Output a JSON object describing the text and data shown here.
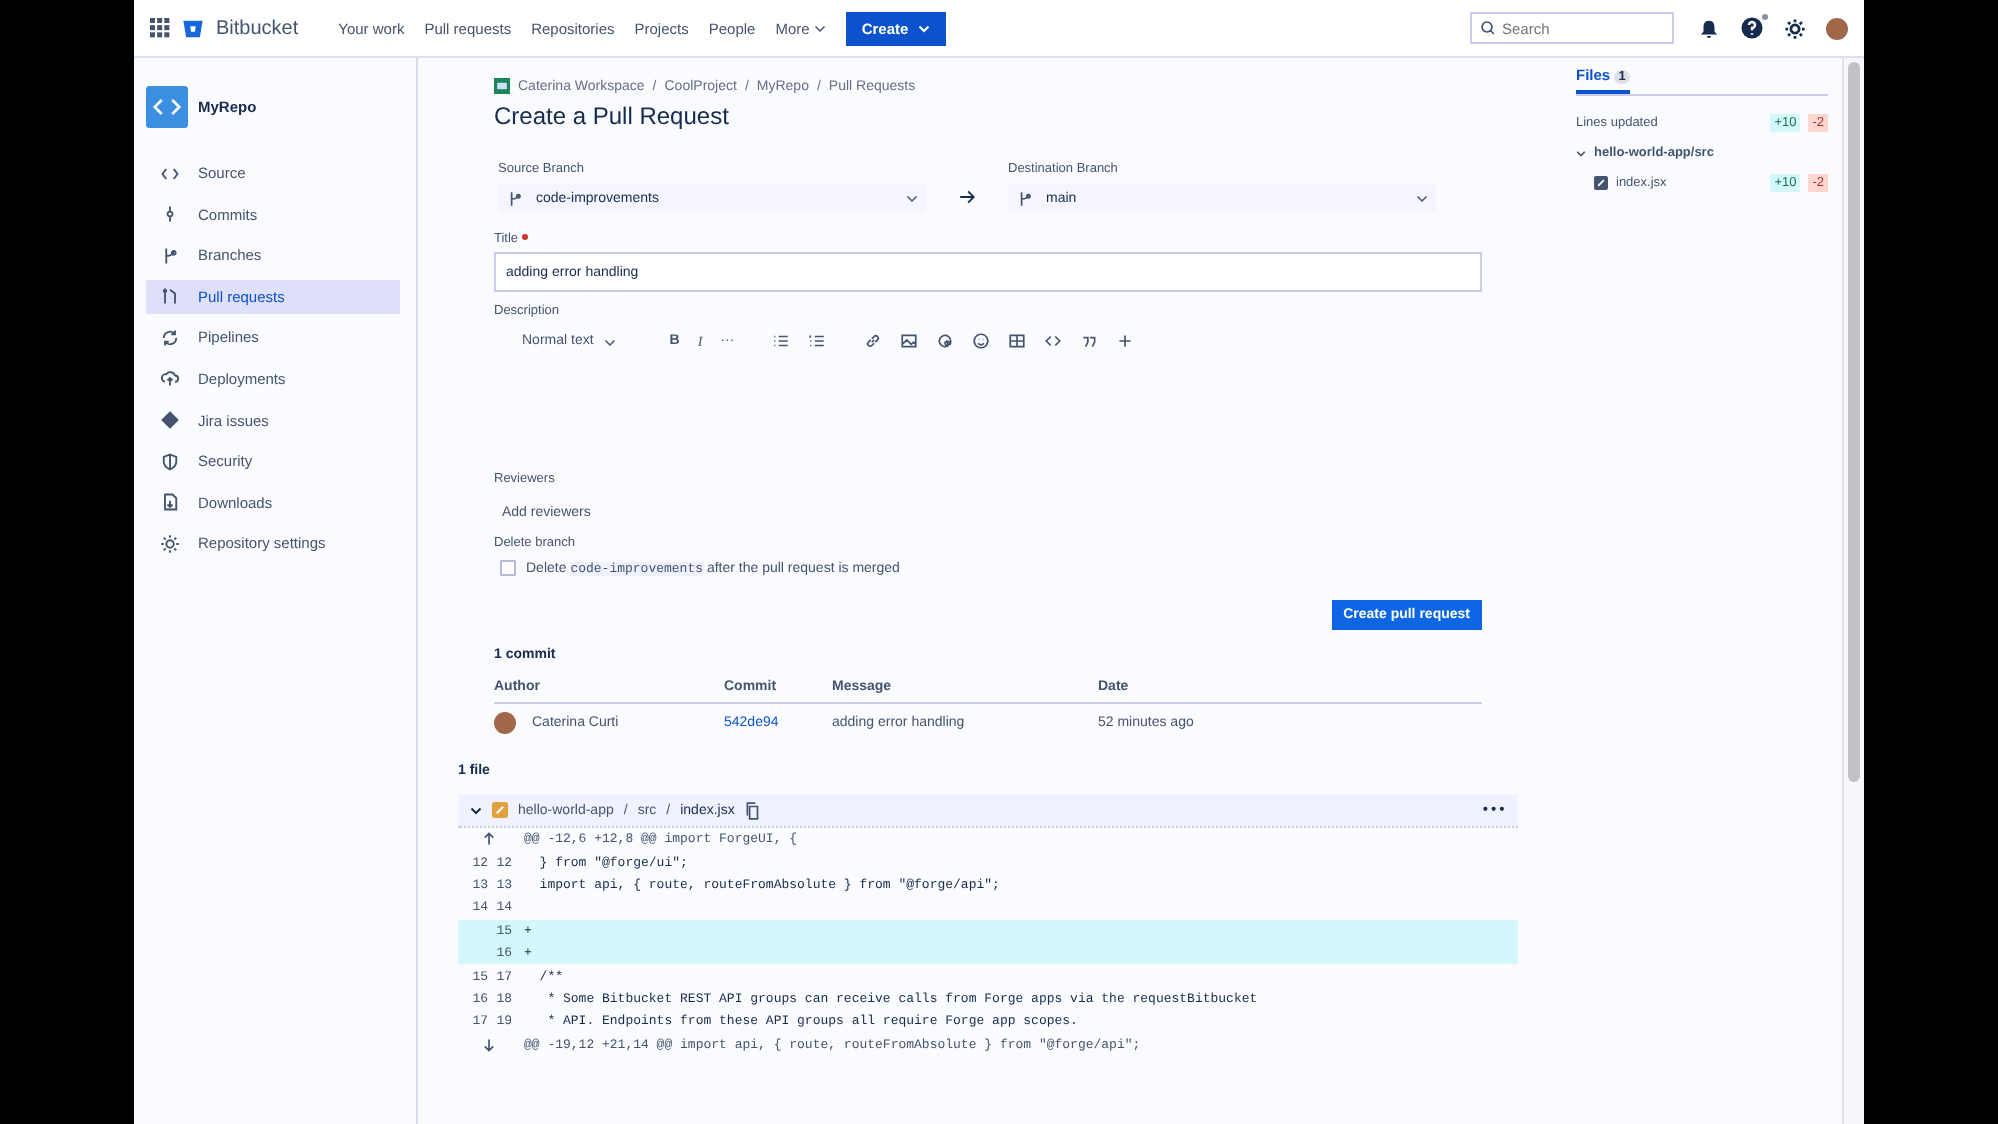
{
  "topbar": {
    "product": "Bitbucket",
    "nav": [
      "Your work",
      "Pull requests",
      "Repositories",
      "Projects",
      "People",
      "More"
    ],
    "create": "Create",
    "search": {
      "placeholder": "Search"
    },
    "help_dot": true
  },
  "sidebar": {
    "repo": "MyRepo",
    "items": [
      {
        "label": "Source",
        "selected": false
      },
      {
        "label": "Commits",
        "selected": false
      },
      {
        "label": "Branches",
        "selected": false
      },
      {
        "label": "Pull requests",
        "selected": true
      },
      {
        "label": "Pipelines",
        "selected": false
      },
      {
        "label": "Deployments",
        "selected": false
      },
      {
        "label": "Jira issues",
        "selected": false
      },
      {
        "label": "Security",
        "selected": false
      },
      {
        "label": "Downloads",
        "selected": false
      },
      {
        "label": "Repository settings",
        "selected": false
      }
    ]
  },
  "breadcrumbs": [
    {
      "label": "Caterina Workspace"
    },
    {
      "separator": "/",
      "label": "CoolProject"
    },
    {
      "separator": "/",
      "label": "MyRepo"
    },
    {
      "separator": "/",
      "label": "Pull Requests"
    }
  ],
  "title": "Create a Pull Request",
  "source_branch": {
    "label": "Source Branch",
    "value": "code-improvements"
  },
  "destination_branch": {
    "label": "Destination Branch",
    "value": "main"
  },
  "title_field": {
    "label": "Title",
    "required": true,
    "value": "adding error handling"
  },
  "description": {
    "label": "Description",
    "format": "Normal text",
    "toolbar_text": [
      "B",
      "I",
      "···"
    ]
  },
  "reviewers": {
    "label": "Reviewers",
    "placeholder": "Add reviewers"
  },
  "delete_branch": {
    "label": "Delete branch",
    "checked": false,
    "before": "Delete",
    "branch": "code-improvements",
    "after": "after the pull request is merged"
  },
  "submit": "Create pull request",
  "commits": {
    "count": "1 commit",
    "columns": [
      "Author",
      "Commit",
      "Message",
      "Date"
    ],
    "rows": [
      {
        "author": "Caterina Curti",
        "commit": "542de94",
        "message": "adding error handling",
        "date": "52 minutes ago"
      }
    ]
  },
  "files_count": "1 file",
  "diff": {
    "path": [
      {
        "label": "hello-world-app"
      },
      {
        "separator": "/",
        "label": "src"
      },
      {
        "separator": "/",
        "label": "index.jsx"
      }
    ],
    "expanded": true,
    "more": "•••",
    "lines": [
      {
        "kind": "hunkup",
        "text": "@@ -12,6 +12,8 @@ import ForgeUI, {"
      },
      {
        "kind": "context",
        "old": "12",
        "new": "12",
        "text": "  } from \"@forge/ui\";"
      },
      {
        "kind": "context",
        "old": "13",
        "new": "13",
        "text": "  import api, { route, routeFromAbsolute } from \"@forge/api\";"
      },
      {
        "kind": "context",
        "old": "14",
        "new": "14"
      },
      {
        "kind": "added",
        "new": "15",
        "text": "+"
      },
      {
        "kind": "added",
        "new": "16",
        "text": "+"
      },
      {
        "kind": "context",
        "old": "15",
        "new": "17",
        "text": "  /**"
      },
      {
        "kind": "context",
        "old": "16",
        "new": "18",
        "text": "   * Some Bitbucket REST API groups can receive calls from Forge apps via the requestBitbucket"
      },
      {
        "kind": "context",
        "old": "17",
        "new": "19",
        "text": "   * API. Endpoints from these API groups all require Forge app scopes."
      },
      {
        "kind": "hunkdown",
        "text": "@@ -19,12 +21,14 @@ import api, { route, routeFromAbsolute } from \"@forge/api\";"
      }
    ]
  },
  "files_panel": {
    "tab": {
      "label": "Files",
      "count": "1",
      "selected": true
    },
    "lines_label": "Lines updated",
    "added": "+10",
    "removed": "-2",
    "tree": [
      {
        "label": "hello-world-app/src",
        "expanded": true,
        "children": [
          {
            "label": "index.jsx",
            "added": "+10",
            "removed": "-2"
          }
        ]
      }
    ]
  }
}
